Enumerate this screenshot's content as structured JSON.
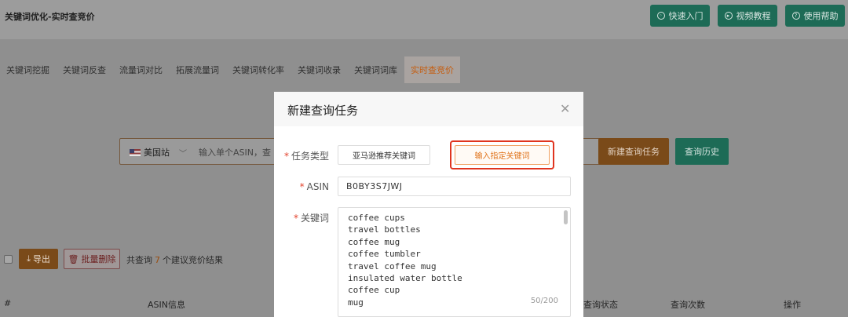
{
  "header": {
    "title": "关键词优化-实时查竞价",
    "buttons": [
      {
        "label": "快速入门",
        "icon": "circle-icon"
      },
      {
        "label": "视频教程",
        "icon": "play-icon"
      },
      {
        "label": "使用帮助",
        "icon": "help-icon"
      }
    ]
  },
  "tabs": [
    {
      "label": "关键词挖掘"
    },
    {
      "label": "关键词反查"
    },
    {
      "label": "流量词对比"
    },
    {
      "label": "拓展流量词"
    },
    {
      "label": "关键词转化率"
    },
    {
      "label": "关键词收录"
    },
    {
      "label": "关键词词库"
    },
    {
      "label": "实时查竞价",
      "active": true
    }
  ],
  "search": {
    "site": "美国站",
    "placeholder": "输入单个ASIN，查",
    "new_task_label": "新建查询任务",
    "history_label": "查询历史"
  },
  "toolbar": {
    "export_label": "导出",
    "delete_label": "批量删除",
    "result_prefix": "共查询",
    "result_count": "7",
    "result_suffix": "个建议竞价结果"
  },
  "table": {
    "headers": [
      "#",
      "ASIN信息",
      "查询状态",
      "查询次数",
      "操作"
    ]
  },
  "modal": {
    "title": "新建查询任务",
    "task_type_label": "任务类型",
    "type_option_1": "亚马逊推荐关键词",
    "type_option_2": "输入指定关键词",
    "asin_label": "ASIN",
    "asin_value": "B0BY3S7JWJ",
    "keyword_label": "关键词",
    "keywords": [
      "coffee cups",
      "travel bottles",
      "coffee mug",
      "coffee tumbler",
      "travel coffee mug",
      "insulated water bottle",
      "coffee cup",
      "mug"
    ],
    "keyword_count": "50/200"
  },
  "colors": {
    "accent_orange": "#e0731a",
    "highlight_red": "#e0341f",
    "green": "#1d6b56"
  }
}
